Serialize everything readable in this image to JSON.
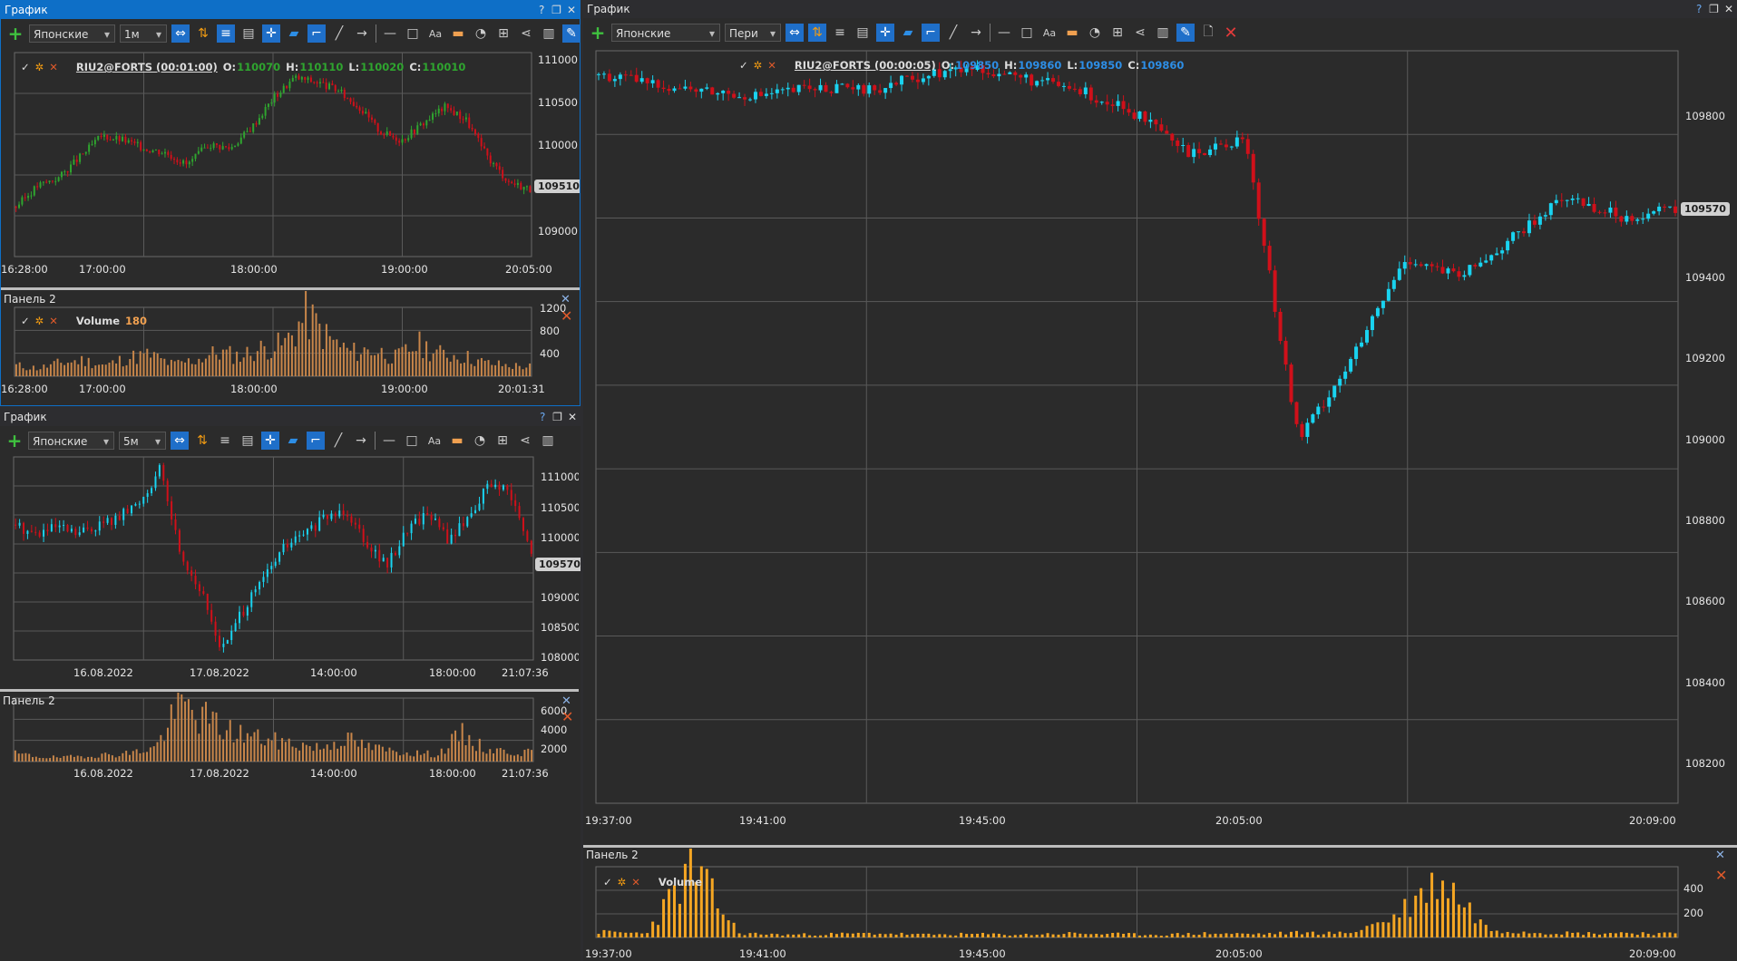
{
  "windows": [
    {
      "title": "График",
      "active": true,
      "toolbar": {
        "style_select": "Японские",
        "timeframe": "1м"
      },
      "main": {
        "legend": {
          "symbol": "RIU2@FORTS (00:01:00)",
          "o_label": "O:",
          "o": "110070",
          "h_label": "H:",
          "h": "110110",
          "l_label": "L:",
          "l": "110020",
          "c_label": "C:",
          "c": "110010"
        },
        "price_tag": "109510",
        "y_ticks": [
          "111000",
          "110500",
          "110000",
          "109500",
          "109000"
        ],
        "x_ticks": [
          "16:28:00",
          "17:00:00",
          "18:00:00",
          "19:00:00",
          "20:05:00"
        ]
      },
      "volume": {
        "title": "Панель 2",
        "legend": {
          "name": "Volume",
          "value": "180"
        },
        "y_ticks": [
          "1200",
          "800",
          "400"
        ],
        "x_ticks": [
          "16:28:00",
          "17:00:00",
          "18:00:00",
          "19:00:00",
          "20:01:31"
        ]
      }
    },
    {
      "title": "График",
      "active": false,
      "toolbar": {
        "style_select": "Японские",
        "timeframe": "5м"
      },
      "main": {
        "price_tag": "109570",
        "y_ticks": [
          "111000",
          "110500",
          "110000",
          "109500",
          "109000",
          "108500",
          "108000"
        ],
        "x_ticks": [
          "16.08.2022",
          "17.08.2022",
          "14:00:00",
          "18:00:00",
          "21:07:36"
        ]
      },
      "volume": {
        "title": "Панель 2",
        "y_ticks": [
          "6000",
          "4000",
          "2000"
        ],
        "x_ticks": [
          "16.08.2022",
          "17.08.2022",
          "14:00:00",
          "18:00:00",
          "21:07:36"
        ]
      }
    },
    {
      "title": "График",
      "active": false,
      "toolbar": {
        "style_select": "Японские",
        "timeframe": "Пери"
      },
      "main": {
        "legend": {
          "symbol": "RIU2@FORTS (00:00:05)",
          "o_label": "O:",
          "o": "109850",
          "h_label": "H:",
          "h": "109860",
          "l_label": "L:",
          "l": "109850",
          "c_label": "C:",
          "c": "109860"
        },
        "price_tag": "109570",
        "y_ticks": [
          "109800",
          "109600",
          "109400",
          "109200",
          "109000",
          "108800",
          "108600",
          "108400",
          "108200"
        ],
        "x_ticks": [
          "19:37:00",
          "19:41:00",
          "19:45:00",
          "20:05:00",
          "20:09:00"
        ]
      },
      "volume": {
        "title": "Панель 2",
        "legend": {
          "name": "Volume"
        },
        "y_ticks": [
          "400",
          "200"
        ],
        "x_ticks": [
          "19:37:00",
          "19:41:00",
          "19:45:00",
          "20:05:00",
          "20:09:00"
        ]
      }
    }
  ],
  "window_buttons": {
    "help": "?",
    "restore": "❐",
    "close": "✕"
  },
  "colors": {
    "up_green": "#2fa52f",
    "down_red": "#d0101a",
    "up_cyan": "#19d3f0",
    "volume_brown": "#c8864a",
    "volume_orange": "#f5a623",
    "grid": "#5a5a5a",
    "accent": "#0e6fc7"
  },
  "chart_data": [
    {
      "type": "candlestick",
      "title": "RIU2@FORTS (00:01:00)",
      "x_range": [
        "16:28:00",
        "20:05:00"
      ],
      "ylim": [
        108700,
        111150
      ],
      "series": [
        {
          "name": "RIU2@FORTS (00:01:00)",
          "values": [
            109300,
            109550,
            109650,
            109900,
            110150,
            110100,
            110000,
            109950,
            109800,
            110050,
            110000,
            110250,
            110600,
            110850,
            110800,
            110700,
            110500,
            110200,
            110100,
            110300,
            110500,
            110350,
            109900,
            109600,
            109510
          ]
        }
      ]
    },
    {
      "type": "bar",
      "title": "Volume",
      "ylim": [
        0,
        1300
      ],
      "series": [
        {
          "name": "Volume",
          "values": [
            200,
            150,
            250,
            300,
            200,
            350,
            400,
            220,
            300,
            450,
            380,
            520,
            600,
            1150,
            700,
            450,
            500,
            350,
            600,
            420,
            380,
            250,
            200,
            180
          ]
        }
      ]
    },
    {
      "type": "candlestick",
      "title": "",
      "x_range": [
        "16.08.2022",
        "21:07:36"
      ],
      "ylim": [
        107950,
        111100
      ],
      "series": [
        {
          "name": "",
          "values": [
            110050,
            109900,
            110000,
            109900,
            110050,
            110150,
            110400,
            110900,
            109600,
            109000,
            108100,
            108700,
            109200,
            109700,
            109900,
            110150,
            110300,
            109800,
            109400,
            110000,
            110250,
            109800,
            110200,
            110700,
            110500,
            109570
          ]
        }
      ]
    },
    {
      "type": "bar",
      "title": "",
      "ylim": [
        0,
        6500
      ],
      "series": [
        {
          "name": "",
          "values": [
            800,
            500,
            400,
            600,
            700,
            900,
            1500,
            5900,
            4500,
            3200,
            2600,
            2100,
            1800,
            1400,
            2400,
            1500,
            1100,
            900,
            700,
            2800,
            1300,
            1000,
            900
          ]
        }
      ]
    },
    {
      "type": "candlestick",
      "title": "RIU2@FORTS (00:00:05)",
      "x_range": [
        "19:37:00",
        "20:09:00"
      ],
      "ylim": [
        108100,
        109960
      ],
      "series": [
        {
          "name": "RIU2@FORTS (00:00:05)",
          "values": [
            109900,
            109880,
            109860,
            109850,
            109870,
            109860,
            109900,
            109920,
            109890,
            109860,
            109800,
            109700,
            109750,
            109000,
            109200,
            109450,
            109400,
            109500,
            109600,
            109550,
            109570
          ]
        }
      ]
    },
    {
      "type": "bar",
      "title": "Volume",
      "ylim": [
        0,
        520
      ],
      "series": [
        {
          "name": "Volume",
          "values": [
            40,
            30,
            510,
            30,
            20,
            25,
            30,
            20,
            25,
            20,
            30,
            25,
            20,
            30,
            25,
            35,
            30,
            150,
            440,
            60,
            40,
            30,
            35,
            25
          ]
        }
      ]
    }
  ]
}
